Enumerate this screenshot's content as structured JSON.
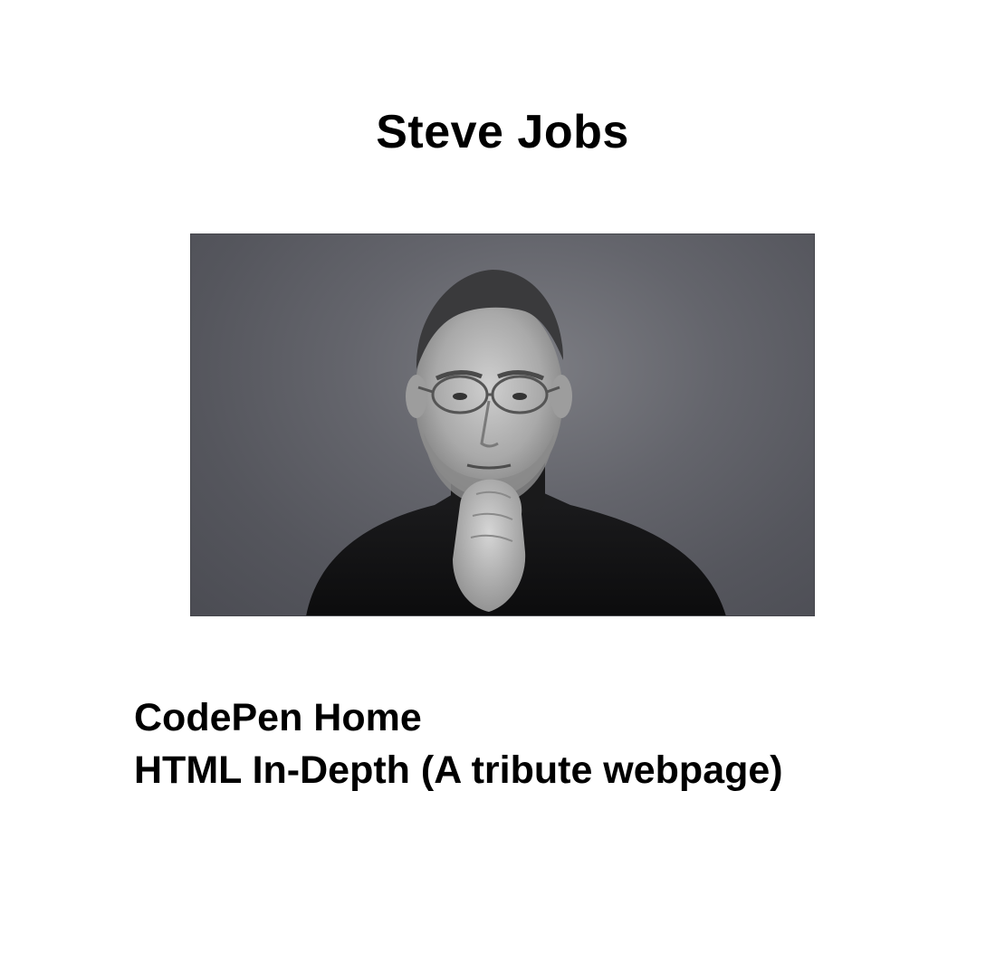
{
  "page": {
    "title": "Steve Jobs",
    "image_subject": "black-and-white-portrait-of-steve-jobs",
    "footer_lines": [
      "CodePen Home",
      "HTML In-Depth (A tribute webpage)"
    ]
  },
  "colors": {
    "background": "#ffffff",
    "text": "#000000",
    "photo_backdrop": "#5a5b62"
  }
}
